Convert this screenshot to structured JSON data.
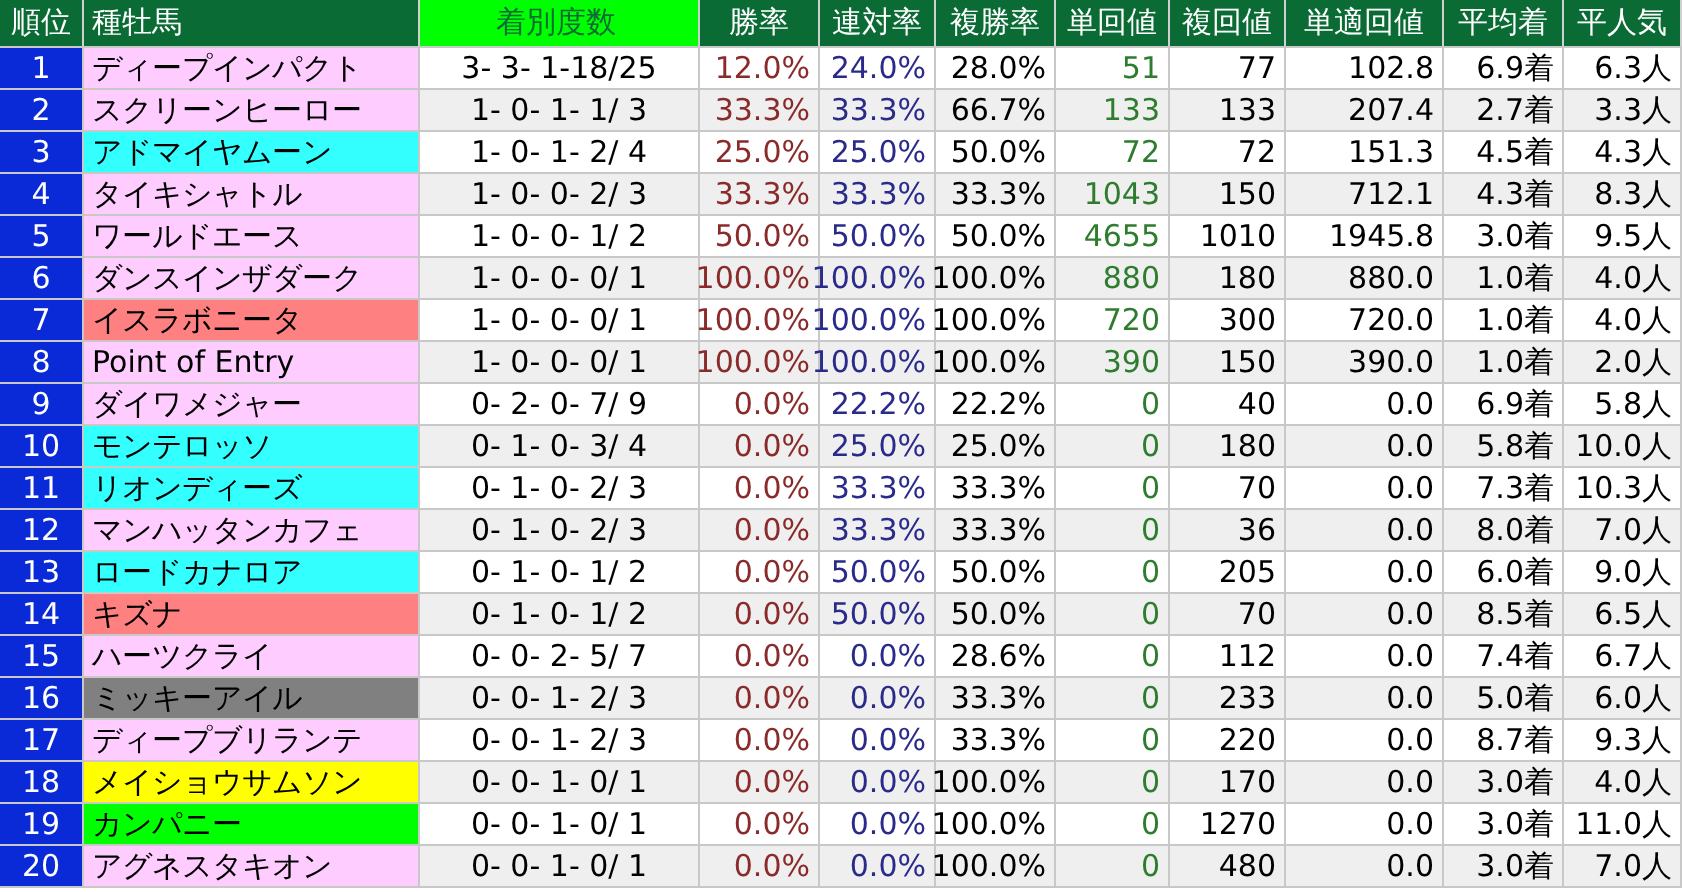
{
  "table": {
    "columns": [
      "順位",
      "種牡馬",
      "着別度数",
      "勝率",
      "連対率",
      "複勝率",
      "単回値",
      "複回値",
      "単適回値",
      "平均着",
      "平人気"
    ],
    "rows": [
      {
        "rank": "1",
        "sire": "ディープインパクト",
        "color": "#ffccff",
        "record": "3- 3- 1-18/25",
        "win": "12.0%",
        "quinella": "24.0%",
        "show": "28.0%",
        "win_return": "51",
        "show_return": "77",
        "adj_return": "102.8",
        "avg_finish": "6.9着",
        "avg_pop": "6.3人"
      },
      {
        "rank": "2",
        "sire": "スクリーンヒーロー",
        "color": "#ffccff",
        "record": "1- 0- 1- 1/ 3",
        "win": "33.3%",
        "quinella": "33.3%",
        "show": "66.7%",
        "win_return": "133",
        "show_return": "133",
        "adj_return": "207.4",
        "avg_finish": "2.7着",
        "avg_pop": "3.3人"
      },
      {
        "rank": "3",
        "sire": "アドマイヤムーン",
        "color": "#33ffff",
        "record": "1- 0- 1- 2/ 4",
        "win": "25.0%",
        "quinella": "25.0%",
        "show": "50.0%",
        "win_return": "72",
        "show_return": "72",
        "adj_return": "151.3",
        "avg_finish": "4.5着",
        "avg_pop": "4.3人"
      },
      {
        "rank": "4",
        "sire": "タイキシャトル",
        "color": "#ffccff",
        "record": "1- 0- 0- 2/ 3",
        "win": "33.3%",
        "quinella": "33.3%",
        "show": "33.3%",
        "win_return": "1043",
        "show_return": "150",
        "adj_return": "712.1",
        "avg_finish": "4.3着",
        "avg_pop": "8.3人"
      },
      {
        "rank": "5",
        "sire": "ワールドエース",
        "color": "#ffccff",
        "record": "1- 0- 0- 1/ 2",
        "win": "50.0%",
        "quinella": "50.0%",
        "show": "50.0%",
        "win_return": "4655",
        "show_return": "1010",
        "adj_return": "1945.8",
        "avg_finish": "3.0着",
        "avg_pop": "9.5人"
      },
      {
        "rank": "6",
        "sire": "ダンスインザダーク",
        "color": "#ffccff",
        "record": "1- 0- 0- 0/ 1",
        "win": "100.0%",
        "quinella": "100.0%",
        "show": "100.0%",
        "win_return": "880",
        "show_return": "180",
        "adj_return": "880.0",
        "avg_finish": "1.0着",
        "avg_pop": "4.0人"
      },
      {
        "rank": "7",
        "sire": "イスラボニータ",
        "color": "#ff8080",
        "record": "1- 0- 0- 0/ 1",
        "win": "100.0%",
        "quinella": "100.0%",
        "show": "100.0%",
        "win_return": "720",
        "show_return": "300",
        "adj_return": "720.0",
        "avg_finish": "1.0着",
        "avg_pop": "4.0人"
      },
      {
        "rank": "8",
        "sire": "Point of Entry",
        "color": "#ffccff",
        "record": "1- 0- 0- 0/ 1",
        "win": "100.0%",
        "quinella": "100.0%",
        "show": "100.0%",
        "win_return": "390",
        "show_return": "150",
        "adj_return": "390.0",
        "avg_finish": "1.0着",
        "avg_pop": "2.0人"
      },
      {
        "rank": "9",
        "sire": "ダイワメジャー",
        "color": "#ffccff",
        "record": "0- 2- 0- 7/ 9",
        "win": "0.0%",
        "quinella": "22.2%",
        "show": "22.2%",
        "win_return": "0",
        "show_return": "40",
        "adj_return": "0.0",
        "avg_finish": "6.9着",
        "avg_pop": "5.8人"
      },
      {
        "rank": "10",
        "sire": "モンテロッソ",
        "color": "#33ffff",
        "record": "0- 1- 0- 3/ 4",
        "win": "0.0%",
        "quinella": "25.0%",
        "show": "25.0%",
        "win_return": "0",
        "show_return": "180",
        "adj_return": "0.0",
        "avg_finish": "5.8着",
        "avg_pop": "10.0人"
      },
      {
        "rank": "11",
        "sire": "リオンディーズ",
        "color": "#33ffff",
        "record": "0- 1- 0- 2/ 3",
        "win": "0.0%",
        "quinella": "33.3%",
        "show": "33.3%",
        "win_return": "0",
        "show_return": "70",
        "adj_return": "0.0",
        "avg_finish": "7.3着",
        "avg_pop": "10.3人"
      },
      {
        "rank": "12",
        "sire": "マンハッタンカフェ",
        "color": "#ffccff",
        "record": "0- 1- 0- 2/ 3",
        "win": "0.0%",
        "quinella": "33.3%",
        "show": "33.3%",
        "win_return": "0",
        "show_return": "36",
        "adj_return": "0.0",
        "avg_finish": "8.0着",
        "avg_pop": "7.0人"
      },
      {
        "rank": "13",
        "sire": "ロードカナロア",
        "color": "#33ffff",
        "record": "0- 1- 0- 1/ 2",
        "win": "0.0%",
        "quinella": "50.0%",
        "show": "50.0%",
        "win_return": "0",
        "show_return": "205",
        "adj_return": "0.0",
        "avg_finish": "6.0着",
        "avg_pop": "9.0人"
      },
      {
        "rank": "14",
        "sire": "キズナ",
        "color": "#ff8080",
        "record": "0- 1- 0- 1/ 2",
        "win": "0.0%",
        "quinella": "50.0%",
        "show": "50.0%",
        "win_return": "0",
        "show_return": "70",
        "adj_return": "0.0",
        "avg_finish": "8.5着",
        "avg_pop": "6.5人"
      },
      {
        "rank": "15",
        "sire": "ハーツクライ",
        "color": "#ffccff",
        "record": "0- 0- 2- 5/ 7",
        "win": "0.0%",
        "quinella": "0.0%",
        "show": "28.6%",
        "win_return": "0",
        "show_return": "112",
        "adj_return": "0.0",
        "avg_finish": "7.4着",
        "avg_pop": "6.7人"
      },
      {
        "rank": "16",
        "sire": "ミッキーアイル",
        "color": "#808080",
        "record": "0- 0- 1- 2/ 3",
        "win": "0.0%",
        "quinella": "0.0%",
        "show": "33.3%",
        "win_return": "0",
        "show_return": "233",
        "adj_return": "0.0",
        "avg_finish": "5.0着",
        "avg_pop": "6.0人"
      },
      {
        "rank": "17",
        "sire": "ディープブリランテ",
        "color": "#ffccff",
        "record": "0- 0- 1- 2/ 3",
        "win": "0.0%",
        "quinella": "0.0%",
        "show": "33.3%",
        "win_return": "0",
        "show_return": "220",
        "adj_return": "0.0",
        "avg_finish": "8.7着",
        "avg_pop": "9.3人"
      },
      {
        "rank": "18",
        "sire": "メイショウサムソン",
        "color": "#ffff00",
        "record": "0- 0- 1- 0/ 1",
        "win": "0.0%",
        "quinella": "0.0%",
        "show": "100.0%",
        "win_return": "0",
        "show_return": "170",
        "adj_return": "0.0",
        "avg_finish": "3.0着",
        "avg_pop": "4.0人"
      },
      {
        "rank": "19",
        "sire": "カンパニー",
        "color": "#00ff00",
        "record": "0- 0- 1- 0/ 1",
        "win": "0.0%",
        "quinella": "0.0%",
        "show": "100.0%",
        "win_return": "0",
        "show_return": "1270",
        "adj_return": "0.0",
        "avg_finish": "3.0着",
        "avg_pop": "11.0人"
      },
      {
        "rank": "20",
        "sire": "アグネスタキオン",
        "color": "#ffccff",
        "record": "0- 0- 1- 0/ 1",
        "win": "0.0%",
        "quinella": "0.0%",
        "show": "100.0%",
        "win_return": "0",
        "show_return": "480",
        "adj_return": "0.0",
        "avg_finish": "3.0着",
        "avg_pop": "7.0人"
      }
    ]
  }
}
